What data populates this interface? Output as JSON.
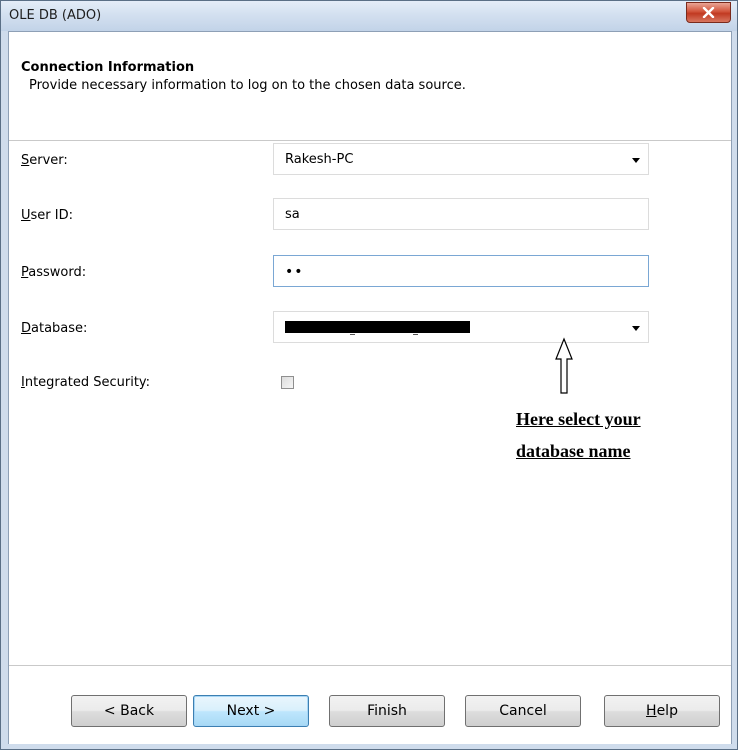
{
  "window": {
    "title": "OLE DB (ADO)",
    "close_icon": "close-icon"
  },
  "header": {
    "title": "Connection Information",
    "subtitle": "Provide necessary information to log on to the chosen data source."
  },
  "form": {
    "server": {
      "label_key": "S",
      "label_rest": "erver:",
      "value": "Rakesh-PC"
    },
    "user_id": {
      "label_key": "U",
      "label_rest": "ser ID:",
      "value": "sa"
    },
    "password": {
      "label_key": "P",
      "label_rest": "assword:",
      "value": "••"
    },
    "database": {
      "label_key": "D",
      "label_rest": "atabase:",
      "value": ""
    },
    "integrated_security": {
      "label_key": "I",
      "label_rest": "ntegrated Security:",
      "checked": false
    }
  },
  "annotation": {
    "line1": "Here select your ",
    "line2": "database name "
  },
  "buttons": {
    "back": "< Back",
    "next": "Next >",
    "finish": "Finish",
    "cancel": "Cancel",
    "help_key": "H",
    "help_rest": "elp"
  },
  "colors": {
    "title_bar": "#d3e0f0",
    "close_button": "#c94b33",
    "default_button_border": "#3c7fb1"
  }
}
